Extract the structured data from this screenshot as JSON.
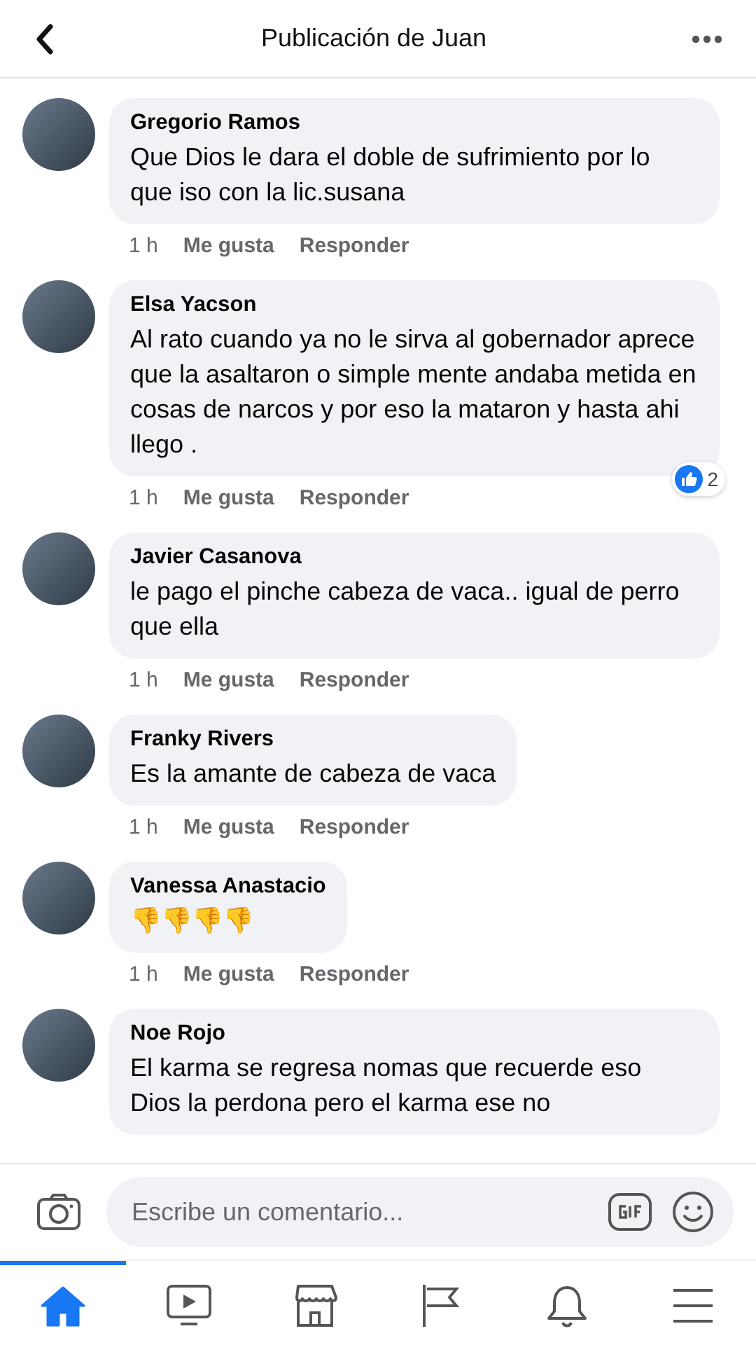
{
  "header": {
    "title": "Publicación de Juan"
  },
  "comments": [
    {
      "author": "Gregorio Ramos",
      "text": "Que Dios le dara el doble de sufrimiento por lo que iso con la lic.susana",
      "time": "1 h",
      "like": "Me gusta",
      "reply": "Responder"
    },
    {
      "author": "Elsa Yacson",
      "text": "Al rato cuando ya no le sirva al gobernador aprece que la asaltaron  o simple mente andaba metida en cosas de narcos y por eso la mataron  y hasta ahi llego .",
      "time": "1 h",
      "like": "Me gusta",
      "reply": "Responder",
      "reactions": "2"
    },
    {
      "author": "Javier Casanova",
      "text": "le pago el pinche cabeza de vaca.. igual de perro que ella",
      "time": "1 h",
      "like": "Me gusta",
      "reply": "Responder"
    },
    {
      "author": "Franky Rivers",
      "text": "Es la amante de cabeza de vaca",
      "time": "1 h",
      "like": "Me gusta",
      "reply": "Responder"
    },
    {
      "author": "Vanessa Anastacio",
      "text": "👎👎👎👎",
      "time": "1 h",
      "like": "Me gusta",
      "reply": "Responder"
    },
    {
      "author": "Noe Rojo",
      "text": "El karma se regresa nomas que recuerde eso Dios la perdona pero el karma ese no"
    }
  ],
  "composer": {
    "placeholder": "Escribe un comentario..."
  },
  "nav": [
    {
      "kind": "home",
      "selected": true
    },
    {
      "kind": "video",
      "selected": false
    },
    {
      "kind": "store",
      "selected": false
    },
    {
      "kind": "flag",
      "selected": false
    },
    {
      "kind": "bell",
      "selected": false
    },
    {
      "kind": "menu",
      "selected": false
    }
  ]
}
